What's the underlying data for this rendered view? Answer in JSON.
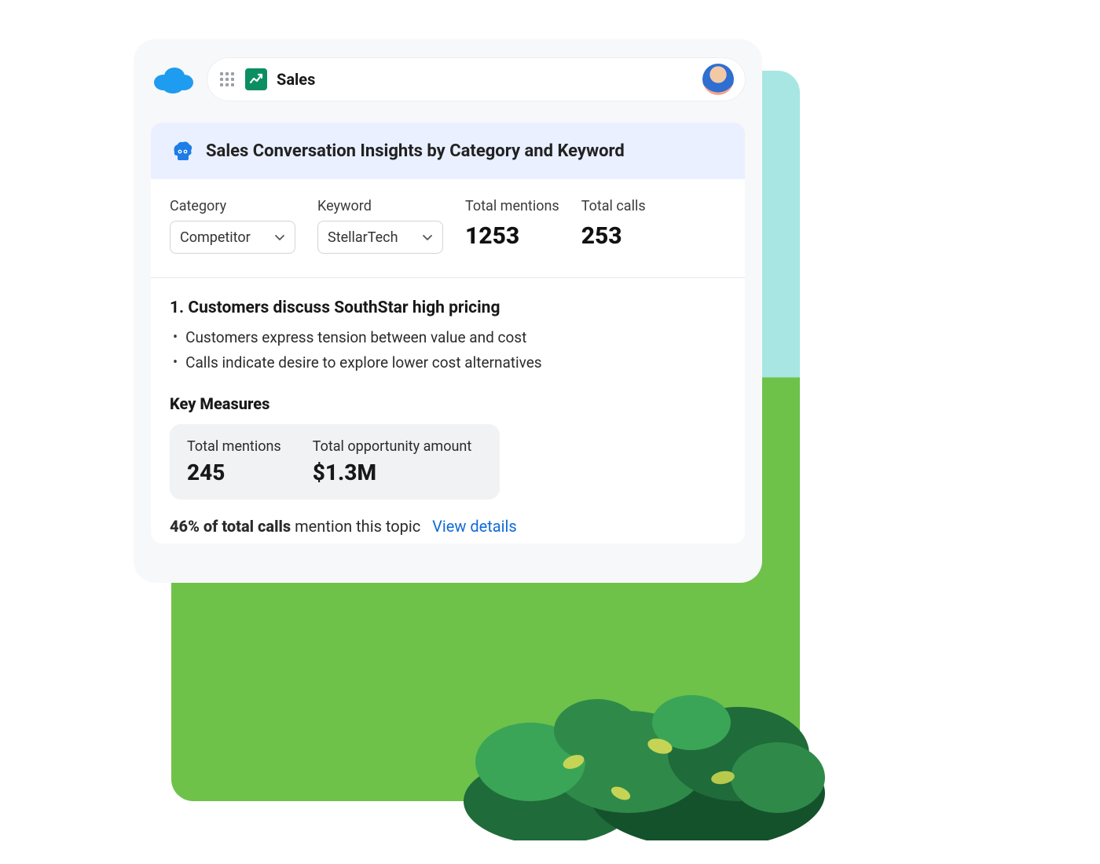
{
  "header": {
    "app_label": "Sales"
  },
  "panel": {
    "title": "Sales Conversation Insights by Category and Keyword"
  },
  "filters": {
    "category_label": "Category",
    "category_value": "Competitor",
    "keyword_label": "Keyword",
    "keyword_value": "StellarTech",
    "total_mentions_label": "Total mentions",
    "total_mentions_value": "1253",
    "total_calls_label": "Total calls",
    "total_calls_value": "253"
  },
  "insight": {
    "title": "1. Customers discuss SouthStar high pricing",
    "bullets": [
      "Customers express tension between value and cost",
      "Calls indicate desire to explore lower cost alternatives"
    ]
  },
  "key_measures": {
    "heading": "Key Measures",
    "total_mentions_label": "Total mentions",
    "total_mentions_value": "245",
    "total_opportunity_label": "Total opportunity amount",
    "total_opportunity_value": "$1.3M"
  },
  "footer": {
    "bold_text": "46% of total calls",
    "rest_text": " mention this topic",
    "link_text": "View details"
  }
}
